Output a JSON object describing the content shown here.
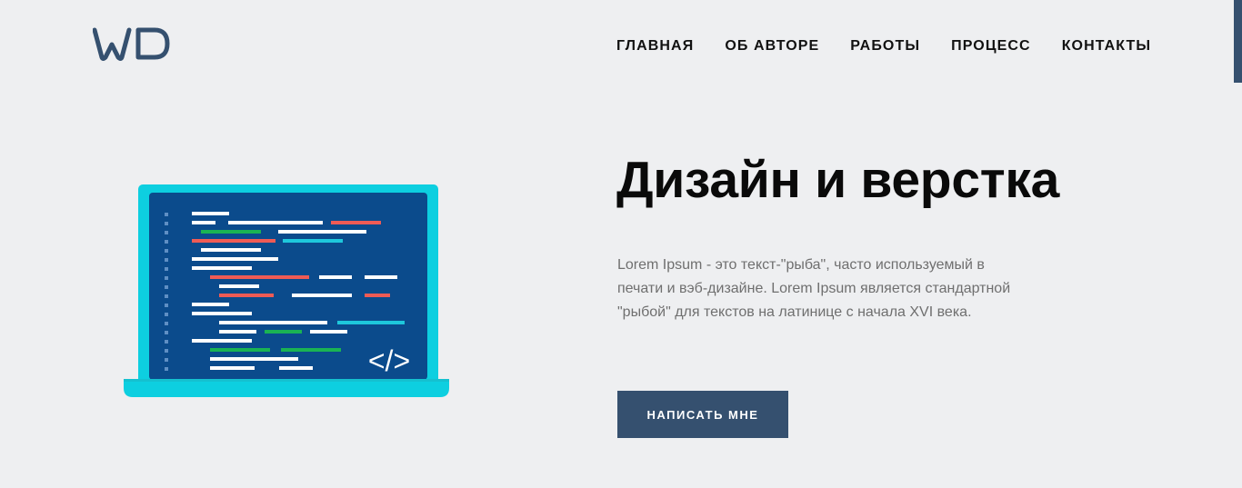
{
  "brand": {
    "logo_text": "WD",
    "color": "#35506f"
  },
  "nav": {
    "items": [
      {
        "label": "ГЛАВНАЯ"
      },
      {
        "label": "ОБ АВТОРЕ"
      },
      {
        "label": "РАБОТЫ"
      },
      {
        "label": "ПРОЦЕСС"
      },
      {
        "label": "КОНТАКТЫ"
      }
    ]
  },
  "hero": {
    "title": "Дизайн и верстка",
    "description": "Lorem Ipsum - это текст-\"рыба\", часто используемый в печати и вэб-дизайне. Lorem Ipsum является стандартной \"рыбой\" для текстов на латинице с начала XVI века.",
    "cta_label": "НАПИСАТЬ МНЕ",
    "illustration": {
      "icon": "laptop-code-icon",
      "code_tag": "</>"
    }
  },
  "colors": {
    "background": "#eeeff1",
    "accent": "#35506f",
    "laptop_frame": "#0dcfe0",
    "laptop_screen": "#0b4b8c"
  }
}
